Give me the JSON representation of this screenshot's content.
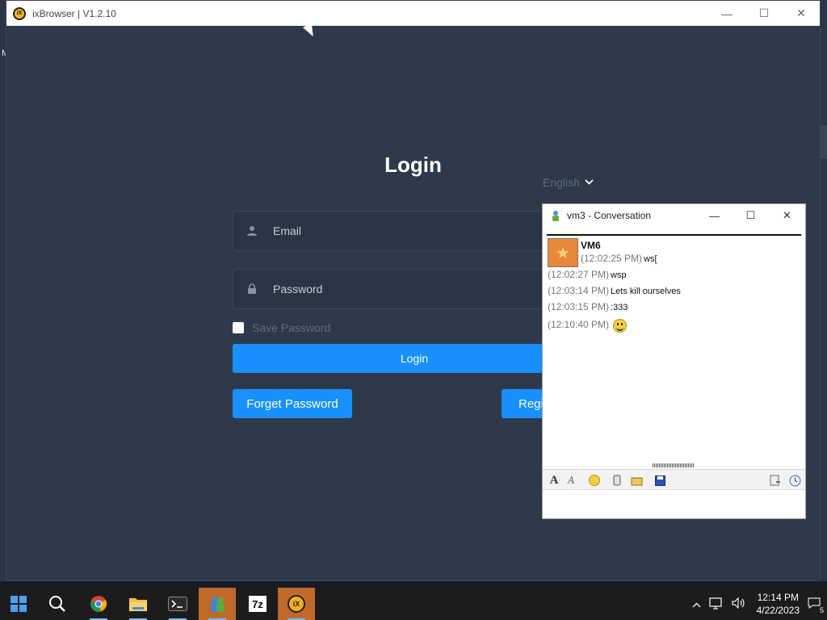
{
  "desktop": {
    "stub_letter": "M"
  },
  "app": {
    "title": "ixBrowser | V1.2.10",
    "logo_text": "iX",
    "controls": {
      "minimize": "—",
      "maximize": "☐",
      "close": "✕"
    },
    "login": {
      "title": "Login",
      "language": "English",
      "email_placeholder": "Email",
      "password_placeholder": "Password",
      "save_password_label": "Save Password",
      "login_button": "Login",
      "forget_password_button": "Forget Password",
      "register_button": "Regi"
    }
  },
  "conversation": {
    "title": "vm3 - Conversation",
    "controls": {
      "minimize": "—",
      "maximize": "☐",
      "close": "✕"
    },
    "sender": "VM6",
    "messages": [
      {
        "time": "(12:02:25 PM)",
        "text": "ws["
      },
      {
        "time": "(12:02:27 PM)",
        "text": "wsp"
      },
      {
        "time": "(12:03:14 PM)",
        "text": "Lets kill ourselves"
      },
      {
        "time": "(12:03:15 PM)",
        "text": ":333"
      },
      {
        "time": "(12:10:40 PM)",
        "text": ""
      }
    ],
    "toolbar_icons": [
      "font-icon",
      "font-color-icon",
      "emoticon-icon",
      "nudge-icon",
      "send-file-icon",
      "save-icon",
      "view-history-icon",
      "clock-icon"
    ]
  },
  "taskbar": {
    "items": [
      "start-icon",
      "search-icon",
      "chrome-icon",
      "file-explorer-icon",
      "terminal-icon",
      "messenger-icon",
      "7zip-icon",
      "ixbrowser-icon"
    ],
    "sevenzip_label": "7z",
    "ix_label": "iX",
    "clock_time": "12:14 PM",
    "clock_date": "4/22/2023",
    "notification_count": "5"
  },
  "colors": {
    "accent": "#1890ff",
    "app_bg": "#2e3a4b",
    "taskbar_active": "#c0692a"
  }
}
